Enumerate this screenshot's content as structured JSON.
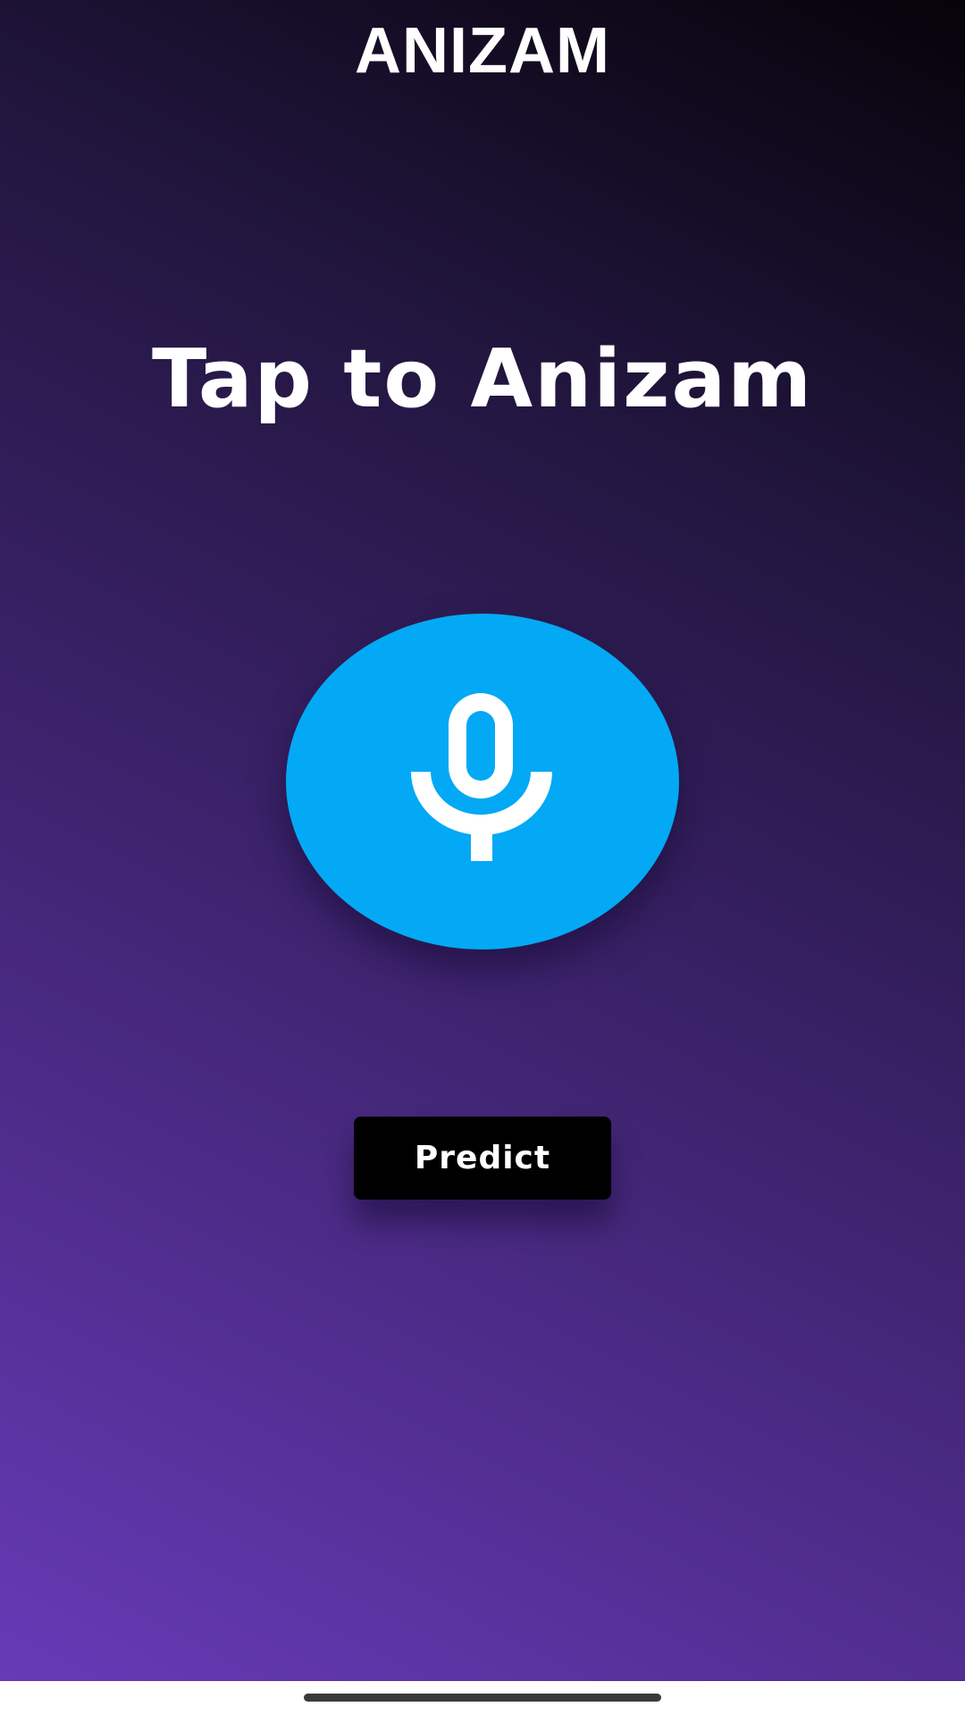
{
  "header": {
    "title": "ANIZAM"
  },
  "main": {
    "headline": "Tap to Anizam",
    "mic_button": {
      "icon": "microphone-icon",
      "color": "#03a9f4"
    },
    "predict_label": "Predict"
  },
  "theme": {
    "gradient_start": "#673ab7",
    "gradient_end": "#060309",
    "button_bg": "#000000",
    "text_color": "#ffffff"
  }
}
